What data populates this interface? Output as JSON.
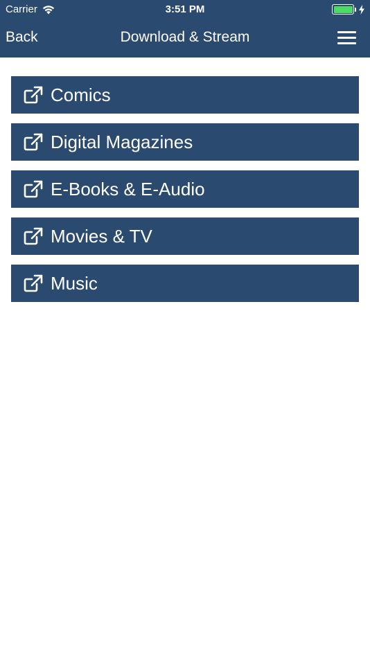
{
  "status_bar": {
    "carrier": "Carrier",
    "time": "3:51 PM",
    "battery_color": "#4cd964"
  },
  "nav": {
    "back_label": "Back",
    "title": "Download & Stream",
    "menu_icon": "hamburger-menu-icon"
  },
  "theme": {
    "primary": "#2b4a70",
    "background": "#ffffff"
  },
  "items": [
    {
      "label": "Comics",
      "icon": "external-link-icon"
    },
    {
      "label": "Digital Magazines",
      "icon": "external-link-icon"
    },
    {
      "label": "E-Books & E-Audio",
      "icon": "external-link-icon"
    },
    {
      "label": "Movies & TV",
      "icon": "external-link-icon"
    },
    {
      "label": "Music",
      "icon": "external-link-icon"
    }
  ]
}
